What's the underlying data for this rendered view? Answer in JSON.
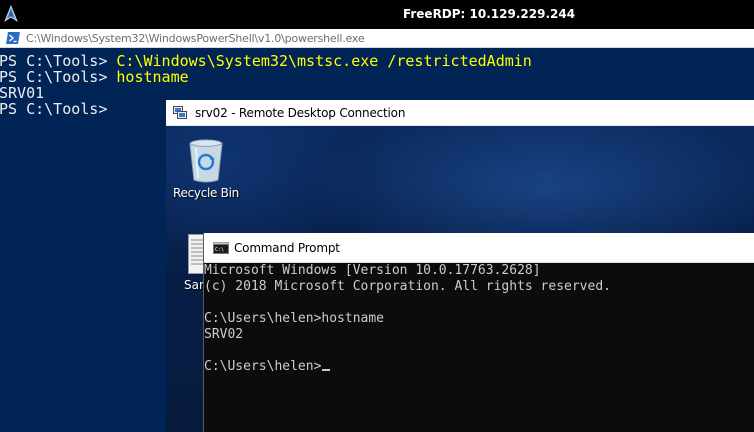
{
  "freerdp": {
    "title": "FreeRDP: 10.129.229.244",
    "icon": "freerdp-icon"
  },
  "powershell": {
    "title": "C:\\Windows\\System32\\WindowsPowerShell\\v1.0\\powershell.exe",
    "icon": "powershell-icon",
    "lines": [
      {
        "prompt": "PS C:\\Tools> ",
        "command": "C:\\Windows\\System32\\mstsc.exe /restrictedAdmin"
      },
      {
        "prompt": "PS C:\\Tools> ",
        "command": "hostname"
      },
      {
        "output": "SRV01"
      },
      {
        "prompt": "PS C:\\Tools> ",
        "command": ""
      }
    ],
    "colors": {
      "background": "#012456",
      "text": "#eeedf0",
      "command": "#ffff00"
    }
  },
  "rdp": {
    "title": "srv02 - Remote Desktop Connection",
    "icon": "remote-desktop-icon",
    "desktop": {
      "recycle_bin_label": "Recycle Bin",
      "file_label_partial": "San"
    }
  },
  "cmd": {
    "title": "Command Prompt",
    "icon": "command-prompt-icon",
    "lines": [
      "Microsoft Windows [Version 10.0.17763.2628]",
      "(c) 2018 Microsoft Corporation. All rights reserved.",
      "",
      "C:\\Users\\helen>hostname",
      "SRV02",
      "",
      "C:\\Users\\helen>"
    ]
  }
}
